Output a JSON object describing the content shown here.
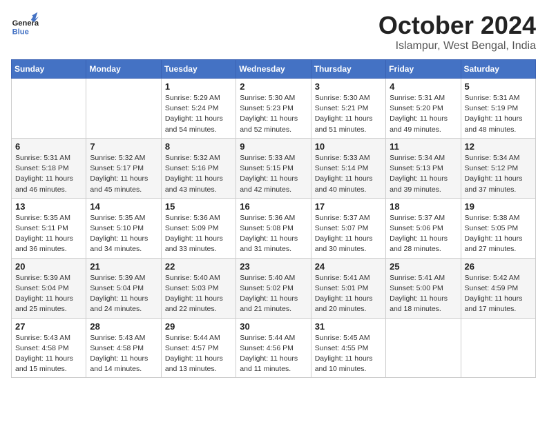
{
  "header": {
    "logo_general": "General",
    "logo_blue": "Blue",
    "month_title": "October 2024",
    "location": "Islampur, West Bengal, India"
  },
  "calendar": {
    "days_of_week": [
      "Sunday",
      "Monday",
      "Tuesday",
      "Wednesday",
      "Thursday",
      "Friday",
      "Saturday"
    ],
    "weeks": [
      [
        {
          "day": "",
          "info": ""
        },
        {
          "day": "",
          "info": ""
        },
        {
          "day": "1",
          "sunrise": "5:29 AM",
          "sunset": "5:24 PM",
          "daylight": "11 hours and 54 minutes."
        },
        {
          "day": "2",
          "sunrise": "5:30 AM",
          "sunset": "5:23 PM",
          "daylight": "11 hours and 52 minutes."
        },
        {
          "day": "3",
          "sunrise": "5:30 AM",
          "sunset": "5:21 PM",
          "daylight": "11 hours and 51 minutes."
        },
        {
          "day": "4",
          "sunrise": "5:31 AM",
          "sunset": "5:20 PM",
          "daylight": "11 hours and 49 minutes."
        },
        {
          "day": "5",
          "sunrise": "5:31 AM",
          "sunset": "5:19 PM",
          "daylight": "11 hours and 48 minutes."
        }
      ],
      [
        {
          "day": "6",
          "sunrise": "5:31 AM",
          "sunset": "5:18 PM",
          "daylight": "11 hours and 46 minutes."
        },
        {
          "day": "7",
          "sunrise": "5:32 AM",
          "sunset": "5:17 PM",
          "daylight": "11 hours and 45 minutes."
        },
        {
          "day": "8",
          "sunrise": "5:32 AM",
          "sunset": "5:16 PM",
          "daylight": "11 hours and 43 minutes."
        },
        {
          "day": "9",
          "sunrise": "5:33 AM",
          "sunset": "5:15 PM",
          "daylight": "11 hours and 42 minutes."
        },
        {
          "day": "10",
          "sunrise": "5:33 AM",
          "sunset": "5:14 PM",
          "daylight": "11 hours and 40 minutes."
        },
        {
          "day": "11",
          "sunrise": "5:34 AM",
          "sunset": "5:13 PM",
          "daylight": "11 hours and 39 minutes."
        },
        {
          "day": "12",
          "sunrise": "5:34 AM",
          "sunset": "5:12 PM",
          "daylight": "11 hours and 37 minutes."
        }
      ],
      [
        {
          "day": "13",
          "sunrise": "5:35 AM",
          "sunset": "5:11 PM",
          "daylight": "11 hours and 36 minutes."
        },
        {
          "day": "14",
          "sunrise": "5:35 AM",
          "sunset": "5:10 PM",
          "daylight": "11 hours and 34 minutes."
        },
        {
          "day": "15",
          "sunrise": "5:36 AM",
          "sunset": "5:09 PM",
          "daylight": "11 hours and 33 minutes."
        },
        {
          "day": "16",
          "sunrise": "5:36 AM",
          "sunset": "5:08 PM",
          "daylight": "11 hours and 31 minutes."
        },
        {
          "day": "17",
          "sunrise": "5:37 AM",
          "sunset": "5:07 PM",
          "daylight": "11 hours and 30 minutes."
        },
        {
          "day": "18",
          "sunrise": "5:37 AM",
          "sunset": "5:06 PM",
          "daylight": "11 hours and 28 minutes."
        },
        {
          "day": "19",
          "sunrise": "5:38 AM",
          "sunset": "5:05 PM",
          "daylight": "11 hours and 27 minutes."
        }
      ],
      [
        {
          "day": "20",
          "sunrise": "5:39 AM",
          "sunset": "5:04 PM",
          "daylight": "11 hours and 25 minutes."
        },
        {
          "day": "21",
          "sunrise": "5:39 AM",
          "sunset": "5:04 PM",
          "daylight": "11 hours and 24 minutes."
        },
        {
          "day": "22",
          "sunrise": "5:40 AM",
          "sunset": "5:03 PM",
          "daylight": "11 hours and 22 minutes."
        },
        {
          "day": "23",
          "sunrise": "5:40 AM",
          "sunset": "5:02 PM",
          "daylight": "11 hours and 21 minutes."
        },
        {
          "day": "24",
          "sunrise": "5:41 AM",
          "sunset": "5:01 PM",
          "daylight": "11 hours and 20 minutes."
        },
        {
          "day": "25",
          "sunrise": "5:41 AM",
          "sunset": "5:00 PM",
          "daylight": "11 hours and 18 minutes."
        },
        {
          "day": "26",
          "sunrise": "5:42 AM",
          "sunset": "4:59 PM",
          "daylight": "11 hours and 17 minutes."
        }
      ],
      [
        {
          "day": "27",
          "sunrise": "5:43 AM",
          "sunset": "4:58 PM",
          "daylight": "11 hours and 15 minutes."
        },
        {
          "day": "28",
          "sunrise": "5:43 AM",
          "sunset": "4:58 PM",
          "daylight": "11 hours and 14 minutes."
        },
        {
          "day": "29",
          "sunrise": "5:44 AM",
          "sunset": "4:57 PM",
          "daylight": "11 hours and 13 minutes."
        },
        {
          "day": "30",
          "sunrise": "5:44 AM",
          "sunset": "4:56 PM",
          "daylight": "11 hours and 11 minutes."
        },
        {
          "day": "31",
          "sunrise": "5:45 AM",
          "sunset": "4:55 PM",
          "daylight": "11 hours and 10 minutes."
        },
        {
          "day": "",
          "info": ""
        },
        {
          "day": "",
          "info": ""
        }
      ]
    ],
    "labels": {
      "sunrise": "Sunrise:",
      "sunset": "Sunset:",
      "daylight": "Daylight:"
    }
  }
}
